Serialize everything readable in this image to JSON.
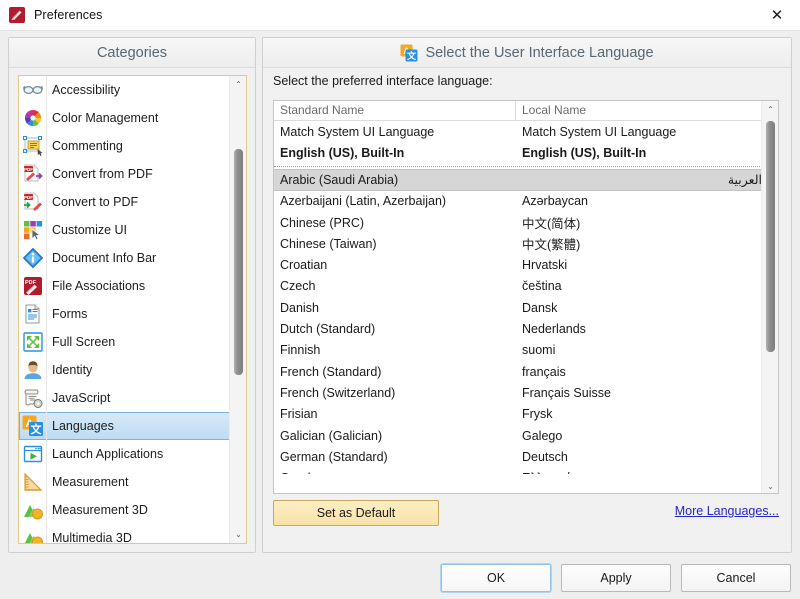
{
  "window": {
    "title": "Preferences",
    "icon": "pdfxchange-icon",
    "close_label": "✕"
  },
  "categories_panel": {
    "header": "Categories",
    "items": [
      {
        "label": "Accessibility",
        "icon": "glasses-icon",
        "selected": false
      },
      {
        "label": "Color Management",
        "icon": "color-wheel-icon",
        "selected": false
      },
      {
        "label": "Commenting",
        "icon": "comment-note-icon",
        "selected": false
      },
      {
        "label": "Convert from PDF",
        "icon": "convert-from-pdf-icon",
        "selected": false
      },
      {
        "label": "Convert to PDF",
        "icon": "convert-to-pdf-icon",
        "selected": false
      },
      {
        "label": "Customize UI",
        "icon": "customize-ui-icon",
        "selected": false
      },
      {
        "label": "Document Info Bar",
        "icon": "info-diamond-icon",
        "selected": false
      },
      {
        "label": "File Associations",
        "icon": "pdf-file-icon",
        "selected": false
      },
      {
        "label": "Forms",
        "icon": "forms-document-icon",
        "selected": false
      },
      {
        "label": "Full Screen",
        "icon": "full-screen-icon",
        "selected": false
      },
      {
        "label": "Identity",
        "icon": "person-icon",
        "selected": false
      },
      {
        "label": "JavaScript",
        "icon": "javascript-scroll-icon",
        "selected": false
      },
      {
        "label": "Languages",
        "icon": "languages-icon",
        "selected": true
      },
      {
        "label": "Launch Applications",
        "icon": "launch-app-icon",
        "selected": false
      },
      {
        "label": "Measurement",
        "icon": "ruler-triangle-icon",
        "selected": false
      },
      {
        "label": "Measurement 3D",
        "icon": "measurement-3d-icon",
        "selected": false
      },
      {
        "label": "Multimedia 3D",
        "icon": "multimedia-3d-icon",
        "selected": false
      }
    ],
    "scrollbar": {
      "up_arrow": "⌃",
      "down_arrow": "⌄"
    }
  },
  "right_panel": {
    "header_title": "Select the User Interface Language",
    "header_icon": "languages-icon",
    "prompt": "Select the preferred interface language:",
    "columns": [
      "Standard Name",
      "Local Name"
    ],
    "pinned_rows": [
      {
        "standard": "Match System UI Language",
        "local": "Match System UI Language",
        "bold": false
      },
      {
        "standard": "English (US), Built-In",
        "local": "English (US), Built-In",
        "bold": true
      }
    ],
    "rows": [
      {
        "standard": "Arabic (Saudi Arabia)",
        "local": "العربية",
        "selected": true,
        "rtl": true
      },
      {
        "standard": "Azerbaijani (Latin, Azerbaijan)",
        "local": "Azərbaycan",
        "selected": false,
        "rtl": false
      },
      {
        "standard": "Chinese (PRC)",
        "local": "中文(简体)",
        "selected": false,
        "rtl": false
      },
      {
        "standard": "Chinese (Taiwan)",
        "local": "中文(繁體)",
        "selected": false,
        "rtl": false
      },
      {
        "standard": "Croatian",
        "local": "Hrvatski",
        "selected": false,
        "rtl": false
      },
      {
        "standard": "Czech",
        "local": "čeština",
        "selected": false,
        "rtl": false
      },
      {
        "standard": "Danish",
        "local": "Dansk",
        "selected": false,
        "rtl": false
      },
      {
        "standard": "Dutch (Standard)",
        "local": "Nederlands",
        "selected": false,
        "rtl": false
      },
      {
        "standard": "Finnish",
        "local": "suomi",
        "selected": false,
        "rtl": false
      },
      {
        "standard": "French (Standard)",
        "local": "français",
        "selected": false,
        "rtl": false
      },
      {
        "standard": "French (Switzerland)",
        "local": "Français Suisse",
        "selected": false,
        "rtl": false
      },
      {
        "standard": "Frisian",
        "local": "Frysk",
        "selected": false,
        "rtl": false
      },
      {
        "standard": "Galician (Galician)",
        "local": "Galego",
        "selected": false,
        "rtl": false
      },
      {
        "standard": "German (Standard)",
        "local": "Deutsch",
        "selected": false,
        "rtl": false
      },
      {
        "standard": "Greek",
        "local": "Ελληνικά",
        "selected": false,
        "rtl": false
      }
    ],
    "set_default_label": "Set as Default",
    "more_languages_label": "More Languages...",
    "scrollbar": {
      "up_arrow": "⌃",
      "down_arrow": "⌄"
    }
  },
  "footer": {
    "ok": "OK",
    "apply": "Apply",
    "cancel": "Cancel"
  },
  "colors": {
    "selection_blue": "#bedcf2",
    "selection_gray": "#d6d6d6",
    "link": "#2727cf",
    "accent_gold": "#f8e2a8",
    "header_text": "#5a6670"
  }
}
